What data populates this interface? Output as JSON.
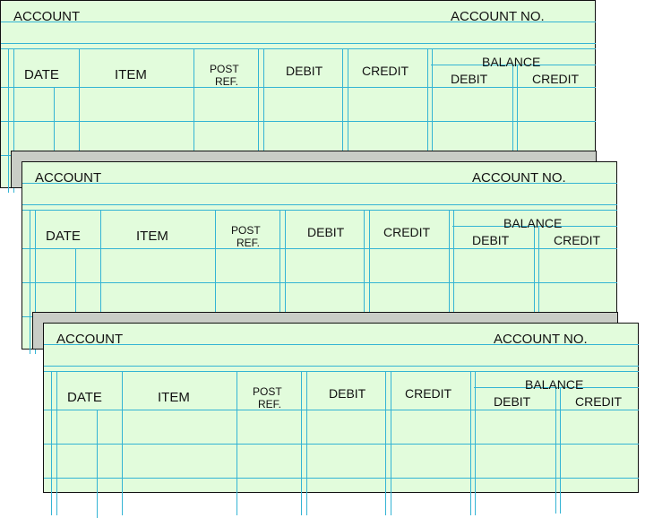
{
  "document": {
    "type": "general-ledger-account-forms",
    "colors": {
      "paper": "#e2fcdc",
      "rule_line": "#34b4d4",
      "shadow": "#c9cdc6",
      "border": "#111111"
    },
    "ledgers": [
      {
        "account_label": "ACCOUNT",
        "account_no_label": "ACCOUNT NO.",
        "columns": {
          "date": "DATE",
          "item": "ITEM",
          "post_ref_line1": "POST",
          "post_ref_line2": "REF.",
          "debit": "DEBIT",
          "credit": "CREDIT",
          "balance": "BALANCE",
          "balance_debit": "DEBIT",
          "balance_credit": "CREDIT"
        }
      },
      {
        "account_label": "ACCOUNT",
        "account_no_label": "ACCOUNT NO.",
        "columns": {
          "date": "DATE",
          "item": "ITEM",
          "post_ref_line1": "POST",
          "post_ref_line2": "REF.",
          "debit": "DEBIT",
          "credit": "CREDIT",
          "balance": "BALANCE",
          "balance_debit": "DEBIT",
          "balance_credit": "CREDIT"
        }
      },
      {
        "account_label": "ACCOUNT",
        "account_no_label": "ACCOUNT NO.",
        "columns": {
          "date": "DATE",
          "item": "ITEM",
          "post_ref_line1": "POST",
          "post_ref_line2": "REF.",
          "debit": "DEBIT",
          "credit": "CREDIT",
          "balance": "BALANCE",
          "balance_debit": "DEBIT",
          "balance_credit": "CREDIT"
        }
      }
    ]
  }
}
